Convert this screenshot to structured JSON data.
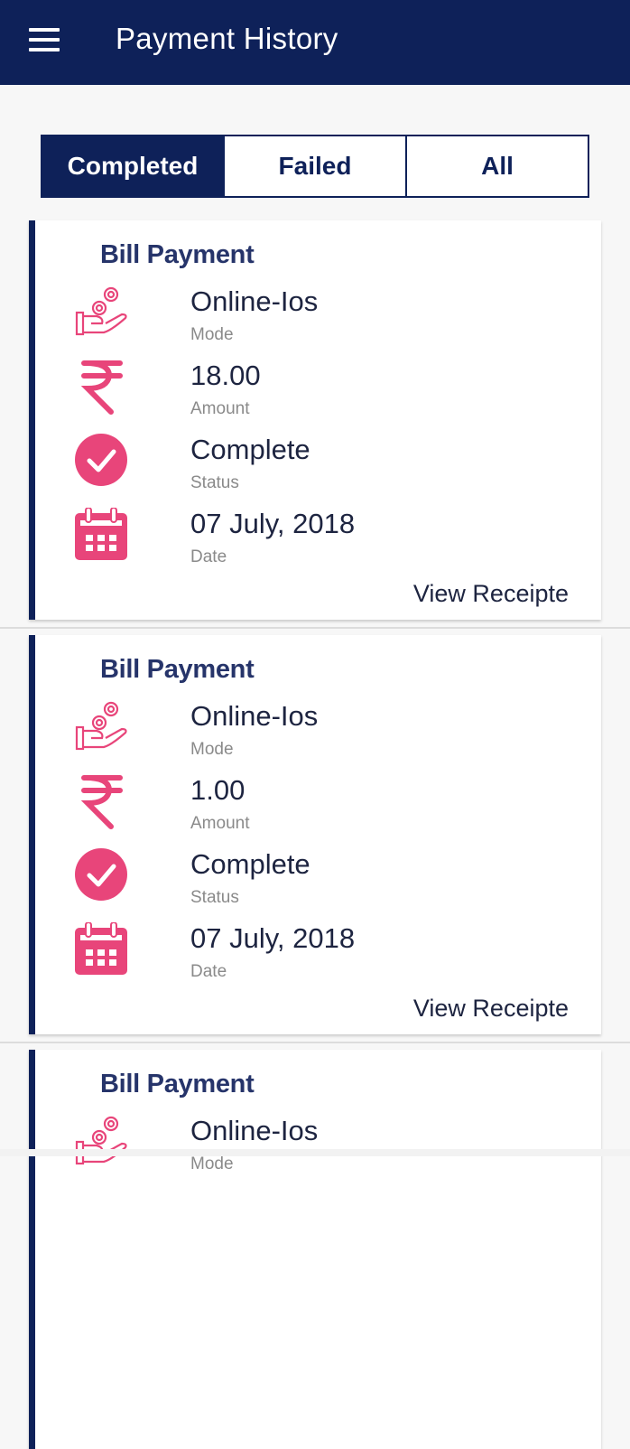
{
  "header": {
    "title": "Payment History",
    "menu_icon": "hamburger-menu-icon"
  },
  "tabs": [
    {
      "label": "Completed",
      "active": true
    },
    {
      "label": "Failed",
      "active": false
    },
    {
      "label": "All",
      "active": false
    }
  ],
  "colors": {
    "primary": "#0e2159",
    "accent": "#e8457a",
    "title_text": "#26346a"
  },
  "payments": [
    {
      "title": "Bill Payment",
      "mode": {
        "value": "Online-Ios",
        "label": "Mode"
      },
      "amount": {
        "value": "18.00",
        "label": "Amount"
      },
      "status": {
        "value": "Complete",
        "label": "Status"
      },
      "date": {
        "value": "07 July, 2018",
        "label": "Date"
      },
      "action": "View Receipte"
    },
    {
      "title": "Bill Payment",
      "mode": {
        "value": "Online-Ios",
        "label": "Mode"
      },
      "amount": {
        "value": "1.00",
        "label": "Amount"
      },
      "status": {
        "value": "Complete",
        "label": "Status"
      },
      "date": {
        "value": "07 July, 2018",
        "label": "Date"
      },
      "action": "View Receipte"
    },
    {
      "title": "Bill Payment",
      "mode": {
        "value": "Online-Ios",
        "label": "Mode"
      }
    }
  ]
}
